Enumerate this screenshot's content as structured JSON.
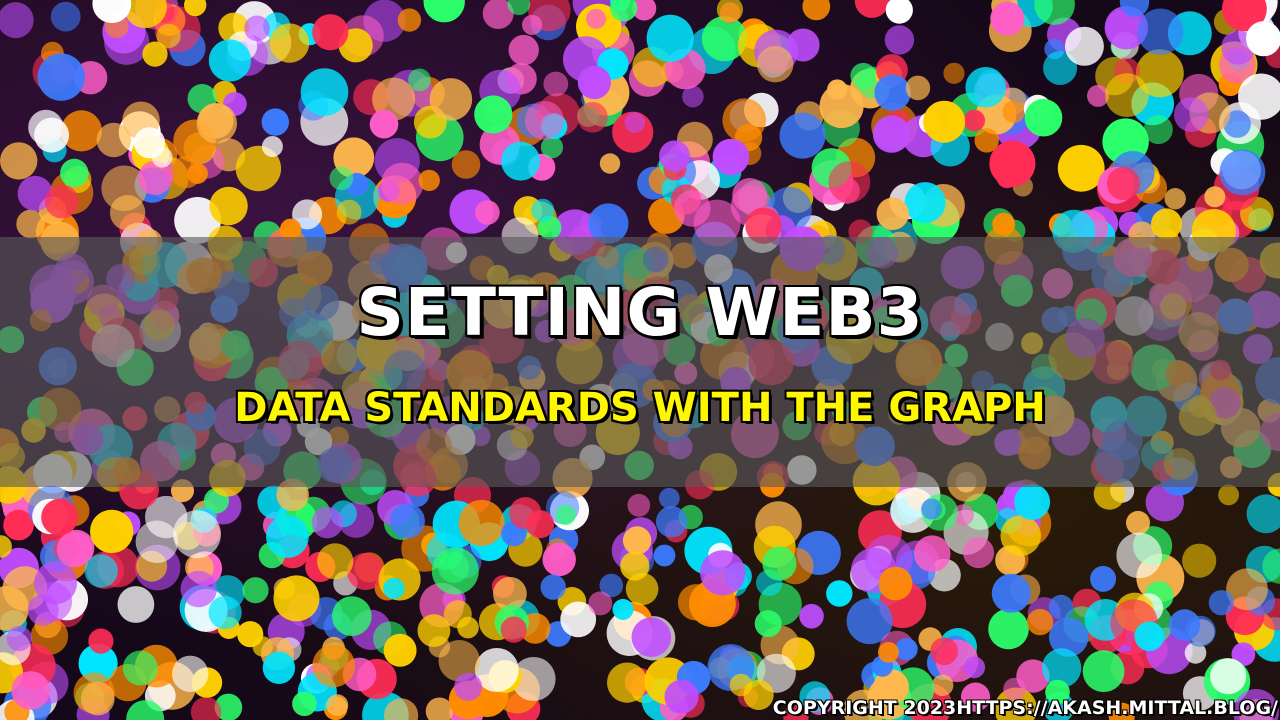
{
  "banner": {
    "title": "SETTING WEB3",
    "subtitle": "DATA STANDARDS WITH THE GRAPH",
    "copyright": "COPYRIGHT 2023HTTPS://AKASH.MITTAL.BLOG/"
  },
  "colors": {
    "title": "#ffffff",
    "subtitle": "#fff700",
    "band": "#5a5a5a",
    "bokeh_palette": [
      "#ff2d55",
      "#ffd000",
      "#00e5ff",
      "#3d7bff",
      "#c04dff",
      "#ff8c00",
      "#2bff6b",
      "#ff5ec8",
      "#ffffff",
      "#ffb84d"
    ]
  },
  "background": {
    "description_icon": "bokeh-lights-background"
  }
}
